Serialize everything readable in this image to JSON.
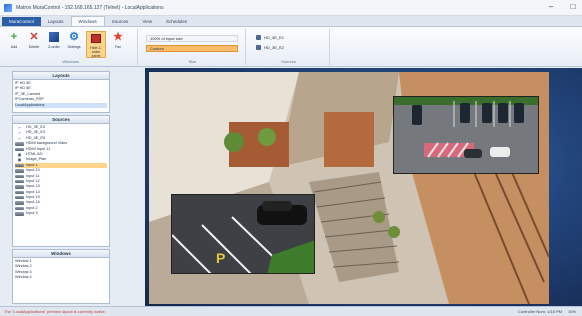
{
  "window": {
    "title": "Matrox MuraControl - 192.168.165.127 (Telnet) - LocalApplications",
    "minimize": "–",
    "maximize": "□"
  },
  "tabs": [
    "MuraControl",
    "Layouts",
    "Windows",
    "Sources",
    "View",
    "Schedules"
  ],
  "active_tab": "Windows",
  "ribbon": {
    "windows_group": {
      "label": "Windows",
      "buttons": [
        {
          "label": "Add",
          "icon": "add-plus-icon"
        },
        {
          "label": "Delete",
          "icon": "delete-x-icon"
        },
        {
          "label": "Z-order",
          "icon": "z-order-icon"
        },
        {
          "label": "Settings",
          "icon": "settings-gear-icon"
        },
        {
          "label": "Hide Z-order panel",
          "icon": "hide-panel-icon"
        },
        {
          "label": "Fav",
          "icon": "star-icon"
        }
      ]
    },
    "size_group": {
      "label": "Size",
      "option1": "100% of input size",
      "option2": "Custom"
    },
    "sources_group": {
      "label": "Sources",
      "items": [
        "HD_3E_E1",
        "HD_3E_E2"
      ]
    }
  },
  "layouts_panel": {
    "title": "Layouts",
    "items": [
      "IP HD 3E",
      "IP HD 6E",
      "IP_3E_Lanned",
      "IPCameras_RSP",
      "LocalApplications"
    ],
    "selected": "LocalApplications"
  },
  "sources_panel": {
    "title": "Sources",
    "items": [
      {
        "label": "HD_3E_E4",
        "kind": "camera"
      },
      {
        "label": "HD_3E_E3",
        "kind": "camera"
      },
      {
        "label": "HD_3E_E5",
        "kind": "camera"
      },
      {
        "label": "HDMI background Video",
        "kind": "input"
      },
      {
        "label": "HDMI Input 11",
        "kind": "input"
      },
      {
        "label": "HTML 6/0",
        "kind": "html"
      },
      {
        "label": "Image_Plan",
        "kind": "image"
      },
      {
        "label": "Input 1",
        "kind": "input"
      },
      {
        "label": "Input 10",
        "kind": "input"
      },
      {
        "label": "Input 11",
        "kind": "input"
      },
      {
        "label": "Input 12",
        "kind": "input"
      },
      {
        "label": "Input 13",
        "kind": "input"
      },
      {
        "label": "Input 14",
        "kind": "input"
      },
      {
        "label": "Input 15",
        "kind": "input"
      },
      {
        "label": "Input 16",
        "kind": "input"
      },
      {
        "label": "Input 2",
        "kind": "input"
      },
      {
        "label": "Input 3",
        "kind": "input"
      }
    ],
    "highlighted": "Input 1"
  },
  "windows_panel": {
    "title": "Windows",
    "items": [
      "Window 1",
      "Window 2",
      "Window 3",
      "Window 4"
    ]
  },
  "status": {
    "message": "The \"LocalApplications\" preview layout is currently active.",
    "right_text": "Controller Num: 1/15 PM",
    "zoom": "10%"
  }
}
